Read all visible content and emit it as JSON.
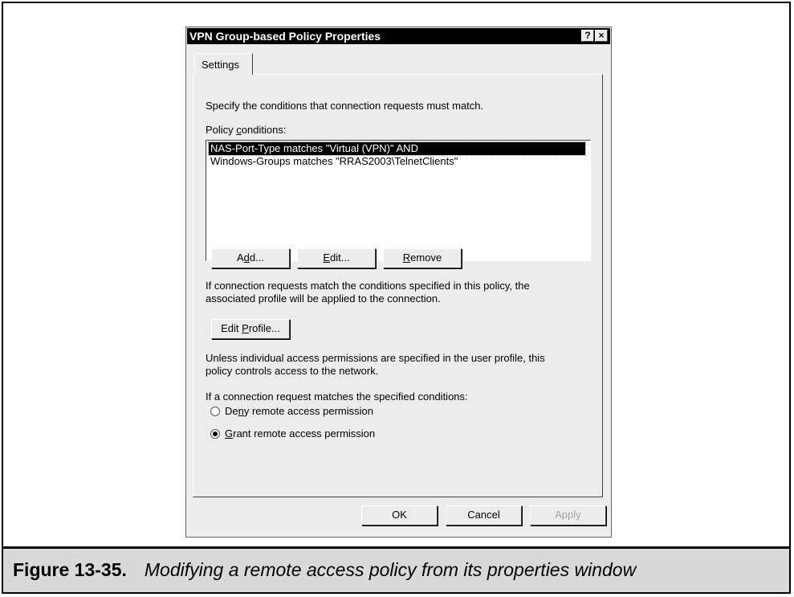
{
  "dialog": {
    "title": "VPN Group-based Policy Properties",
    "help_glyph": "?",
    "close_glyph": "×",
    "tab_label": "Settings"
  },
  "settings": {
    "intro": "Specify the conditions that connection requests must match.",
    "policy_conditions_label_pre": "Policy ",
    "policy_conditions_label_accel": "c",
    "policy_conditions_label_post": "onditions:",
    "conditions": [
      "NAS-Port-Type matches \"Virtual (VPN)\" AND",
      "Windows-Groups matches \"RRAS2003\\TelnetClients\""
    ],
    "add_button": {
      "pre": "A",
      "accel": "d",
      "post": "d..."
    },
    "edit_button": {
      "pre": "",
      "accel": "E",
      "post": "dit..."
    },
    "remove_button": {
      "pre": "",
      "accel": "R",
      "post": "emove"
    },
    "profile_note_line1": "If connection requests match the conditions specified in this policy, the",
    "profile_note_line2": "associated profile will be applied to the connection.",
    "edit_profile_button": {
      "pre": "Edit ",
      "accel": "P",
      "post": "rofile..."
    },
    "access_note_line1": "Unless individual access permissions are specified in the user profile, this",
    "access_note_line2": "policy controls access to the network.",
    "match_label": "If a connection request matches the specified conditions:",
    "deny_option": {
      "pre": "De",
      "accel": "n",
      "post": "y remote access permission"
    },
    "grant_option": {
      "pre": "",
      "accel": "G",
      "post": "rant remote access permission"
    },
    "selected_option": "grant"
  },
  "footer": {
    "ok": "OK",
    "cancel": "Cancel",
    "apply": "Apply"
  },
  "caption": {
    "figure": "Figure 13-35.",
    "text": "Modifying a remote access policy from its properties window"
  }
}
